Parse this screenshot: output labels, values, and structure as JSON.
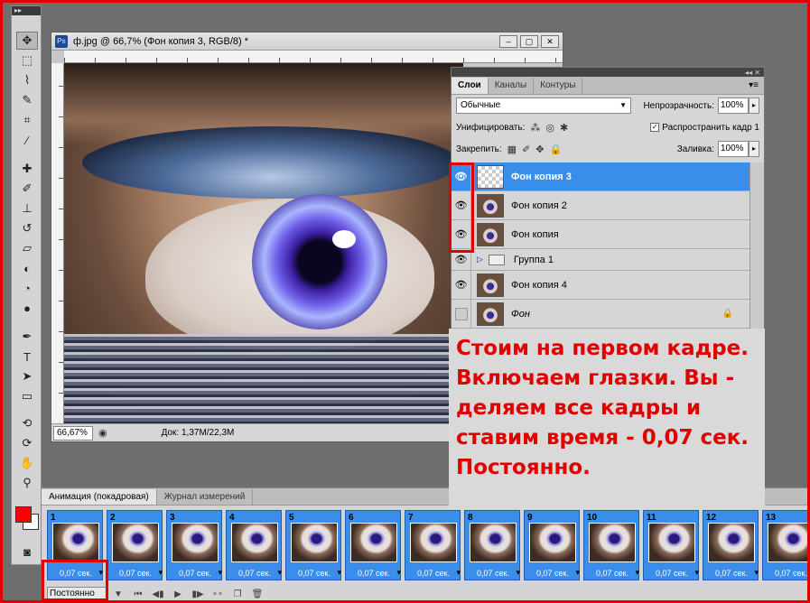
{
  "document": {
    "title": "ф.jpg @ 66,7% (Фон копия 3, RGB/8) *",
    "ps_badge": "Ps",
    "zoom": "66,67%",
    "status": "Док: 1,37M/22,3M"
  },
  "layers_panel": {
    "tabs": [
      "Слои",
      "Каналы",
      "Контуры"
    ],
    "blend_mode": "Обычные",
    "opacity_label": "Непрозрачность:",
    "opacity_value": "100%",
    "unify_label": "Унифицировать:",
    "propagate_label": "Распространить кадр 1",
    "lock_label": "Закрепить:",
    "fill_label": "Заливка:",
    "fill_value": "100%",
    "layers": [
      {
        "name": "Фон копия 3",
        "selected": true,
        "visible": true
      },
      {
        "name": "Фон копия 2",
        "selected": false,
        "visible": true
      },
      {
        "name": "Фон копия",
        "selected": false,
        "visible": true
      },
      {
        "name": "Группа 1",
        "selected": false,
        "visible": true,
        "group": true
      },
      {
        "name": "Фон копия 4",
        "selected": false,
        "visible": true
      },
      {
        "name": "Фон",
        "selected": false,
        "visible": false,
        "locked": true
      }
    ]
  },
  "annotation": {
    "lines": [
      "Стоим на первом кадре.",
      "Включаем глазки. Вы -",
      "деляем все кадры и",
      "ставим время - 0,07 сек.",
      "Постоянно."
    ]
  },
  "animation_panel": {
    "tabs": [
      "Анимация (покадровая)",
      "Журнал измерений"
    ],
    "frames": [
      {
        "num": "1",
        "time": "0,07 сек."
      },
      {
        "num": "2",
        "time": "0,07 сек."
      },
      {
        "num": "3",
        "time": "0,07 сек."
      },
      {
        "num": "4",
        "time": "0,07 сек."
      },
      {
        "num": "5",
        "time": "0,07 сек."
      },
      {
        "num": "6",
        "time": "0,07 сек."
      },
      {
        "num": "7",
        "time": "0,07 сек."
      },
      {
        "num": "8",
        "time": "0,07 сек."
      },
      {
        "num": "9",
        "time": "0,07 сек."
      },
      {
        "num": "10",
        "time": "0,07 сек."
      },
      {
        "num": "11",
        "time": "0,07 сек."
      },
      {
        "num": "12",
        "time": "0,07 сек."
      },
      {
        "num": "13",
        "time": "0,07 сек."
      }
    ],
    "loop": "Постоянно"
  },
  "colors": {
    "accent": "#3a8eea",
    "annotation": "#e00000",
    "foreground": "#ff0000",
    "background": "#ffffff"
  }
}
